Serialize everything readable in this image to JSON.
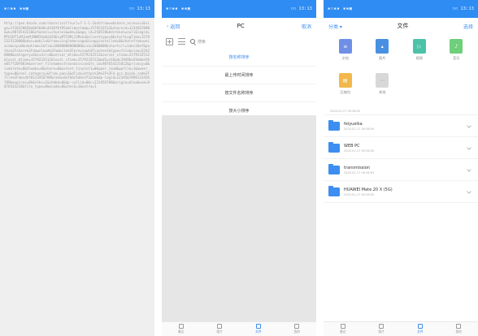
{
  "statusbar": {
    "icons": "▪▫▪▪ ▪▪▣",
    "time": "▫▫ 13:13"
  },
  "phone1": {
    "url_text": "http://pan.baidu.com/share/init?surl=7-1-1-1&shfrom=e&share_access=1&sign=2f20320050a0b5b60c4410f0f85e&timestamp=1579232512&shareid=1234567890&uk=9876543210&channel=chunlei&web=1&app_id=250528&bdstoken=null&logid=MTU3OTIzMjUxMjM0NTAuNzU2ODcyMTI5MjI3Mzk4&clienttype=0&startLogTime=1579232512000&bdxs=mobile&from=singlemessage&isappinstalled=0&sharefrom=weixin&vip=0&newtime=1&fid=10000000000000&cid=2000000&shorturl=1abc2def&path=%2Fshare%2Fdownload%2Fmobile%2Fpreview%2Fcontent&type=file&size=52428800&category=6&isdir=0&server_mtime=1579232512&server_ctime=1579232512&local_mtime=1579232512&local_ctime=1579232512&md5=e10adc3949ba59abbe56e057f20f883e&server_filename=transmission&fs_id=987654321012&privacy=0&isdelete=0&thumbs=0&share=0&extent_tinyint1=0&oper_id=0&wpfile=1&owner_type=0&real_category=&from_pan=1&dlink=https%3A%2F%2Fd.pcs.baidu.com%2Ffile%2Fabcdef0123456789&rand=8a7b6c5d4e3f2a1b&dp-logid=1234567890123456789&expires=8h&chkv=1&chkbd=0&dp-callid=0&r=123456789&origin=dlna&vuk=9876543210&file_type=0&ecode=0&check=1&extra=1"
  },
  "phone2": {
    "back_label": "返回",
    "title": "PC",
    "cancel_label": "取消",
    "search_placeholder": "搜索",
    "sort_options": [
      {
        "label": "按名称排序"
      },
      {
        "label": "最上传时间排序"
      },
      {
        "label": "按文件名称排序"
      },
      {
        "label": "按大小排序"
      }
    ],
    "nav": [
      {
        "label": "最近"
      },
      {
        "label": "图片"
      },
      {
        "label": "文件"
      },
      {
        "label": "我的"
      }
    ]
  },
  "phone3": {
    "left_label": "分类 ▾",
    "title": "文件",
    "right_label": "选择",
    "grid": [
      {
        "label": "文档",
        "icon": "doc-icon",
        "color": "#6f8fe6",
        "glyph": "≡"
      },
      {
        "label": "图片",
        "icon": "image-icon",
        "color": "#4a90e2",
        "glyph": "▴"
      },
      {
        "label": "视频",
        "icon": "video-icon",
        "color": "#4cc2a8",
        "glyph": "▷"
      },
      {
        "label": "音乐",
        "icon": "music-icon",
        "color": "#6fcf7a",
        "glyph": "♪"
      },
      {
        "label": "压缩包",
        "icon": "archive-icon",
        "color": "#f2b84b",
        "glyph": "▤"
      },
      {
        "label": "其他",
        "icon": "more-icon",
        "color": "#d8d8d8",
        "glyph": "⋯"
      }
    ],
    "cut_date": "2020-01-17 09:38:05",
    "folders": [
      {
        "name": "feiyuelka",
        "date": "2020-01-17 09:38:05"
      },
      {
        "name": "WEB PC",
        "date": "2020-01-17 09:38:05"
      },
      {
        "name": "transmission",
        "date": "2020-01-17 09:38:05"
      },
      {
        "name": "HUAWEI Mate 20 X (5G)",
        "date": "2020-01-17 09:38:05"
      }
    ],
    "nav": [
      {
        "label": "最近"
      },
      {
        "label": "图片"
      },
      {
        "label": "文件"
      },
      {
        "label": "我的"
      }
    ]
  }
}
